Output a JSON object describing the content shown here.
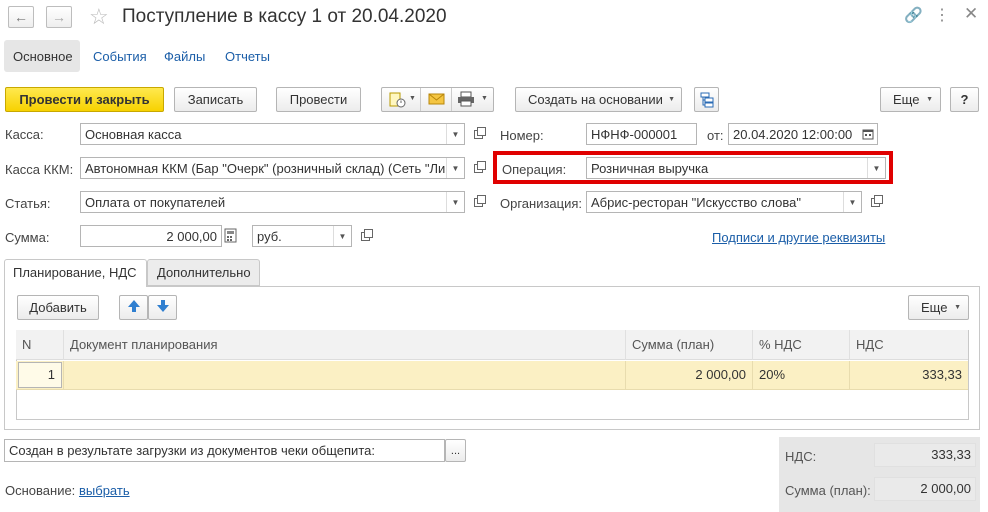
{
  "window": {
    "title": "Поступление в кассу 1 от 20.04.2020"
  },
  "tabs": [
    {
      "label": "Основное"
    },
    {
      "label": "События"
    },
    {
      "label": "Файлы"
    },
    {
      "label": "Отчеты"
    }
  ],
  "toolbar": {
    "post_close": "Провести и закрыть",
    "save": "Записать",
    "post": "Провести",
    "create_based": "Создать на основании",
    "more": "Еще",
    "help": "?"
  },
  "form": {
    "kassa": {
      "label": "Касса:",
      "value": "Основная касса"
    },
    "kassa_kkm": {
      "label": "Касса ККМ:",
      "value": "Автономная ККМ (Бар \"Очерк\" (розничный склад)  (Сеть \"Ли"
    },
    "statya": {
      "label": "Статья:",
      "value": "Оплата от покупателей"
    },
    "summa": {
      "label": "Сумма:",
      "value": "2 000,00",
      "currency": "руб."
    },
    "nomer": {
      "label": "Номер:",
      "value": "НФНФ-000001"
    },
    "ot": {
      "label": "от:",
      "value": "20.04.2020 12:00:00"
    },
    "operacia": {
      "label": "Операция:",
      "value": "Розничная выручка"
    },
    "organizacia": {
      "label": "Организация:",
      "value": "Абрис-ресторан \"Искусство слова\""
    },
    "signatures_link": "Подписи и другие реквизиты"
  },
  "subtabs": [
    {
      "label": "Планирование, НДС"
    },
    {
      "label": "Дополнительно"
    }
  ],
  "table_toolbar": {
    "add": "Добавить",
    "more": "Еще"
  },
  "table": {
    "columns": [
      "N",
      "Документ планирования",
      "Сумма (план)",
      "% НДС",
      "НДС"
    ],
    "rows": [
      {
        "n": "1",
        "doc": "",
        "sum": "2 000,00",
        "vat_rate": "20%",
        "vat": "333,33"
      }
    ]
  },
  "comment": "Создан в результате загрузки из документов чеки общепита:",
  "basis": {
    "label": "Основание:",
    "link": "выбрать"
  },
  "totals": {
    "vat_label": "НДС:",
    "vat_value": "333,33",
    "plan_label": "Сумма (план):",
    "plan_value": "2 000,00"
  },
  "colors": {
    "accent_yellow": "#f7d200",
    "highlight_red": "#e00000",
    "row_selected": "#fbf0c4",
    "link_blue": "#1b5ea8"
  }
}
